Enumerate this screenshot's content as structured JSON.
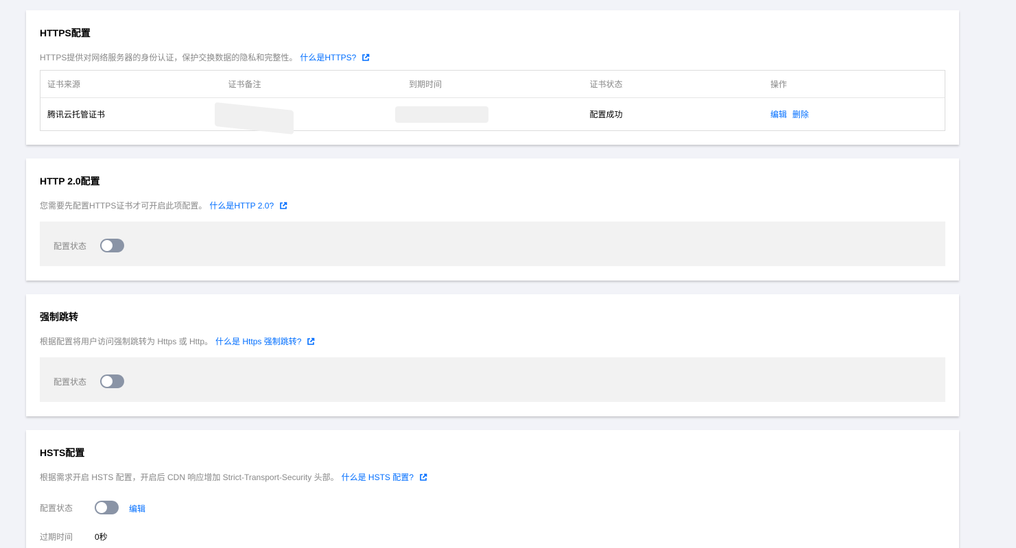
{
  "https": {
    "title": "HTTPS配置",
    "desc": "HTTPS提供对网络服务器的身份认证，保护交换数据的隐私和完整性。",
    "link": "什么是HTTPS?",
    "table": {
      "headers": [
        "证书来源",
        "证书备注",
        "到期时间",
        "证书状态",
        "操作"
      ],
      "row": {
        "source": "腾讯云托管证书",
        "status": "配置成功",
        "actions": [
          "编辑",
          "删除"
        ]
      }
    }
  },
  "http2": {
    "title": "HTTP 2.0配置",
    "desc": "您需要先配置HTTPS证书才可开启此项配置。",
    "link": "什么是HTTP 2.0?",
    "status_label": "配置状态"
  },
  "redirect": {
    "title": "强制跳转",
    "desc": "根据配置将用户访问强制跳转为 Https 或 Http。",
    "link": "什么是 Https 强制跳转?",
    "status_label": "配置状态"
  },
  "hsts": {
    "title": "HSTS配置",
    "desc": "根据需求开启 HSTS 配置，开启后 CDN 响应增加 Strict-Transport-Security 头部。",
    "link": "什么是 HSTS 配置?",
    "status_label": "配置状态",
    "edit": "编辑",
    "expire_label": "过期时间",
    "expire_value": "0秒"
  },
  "colors": {
    "link": "#006eff",
    "toggle_off": "#8a94a6"
  },
  "icons": {
    "external": "external-link-icon"
  }
}
